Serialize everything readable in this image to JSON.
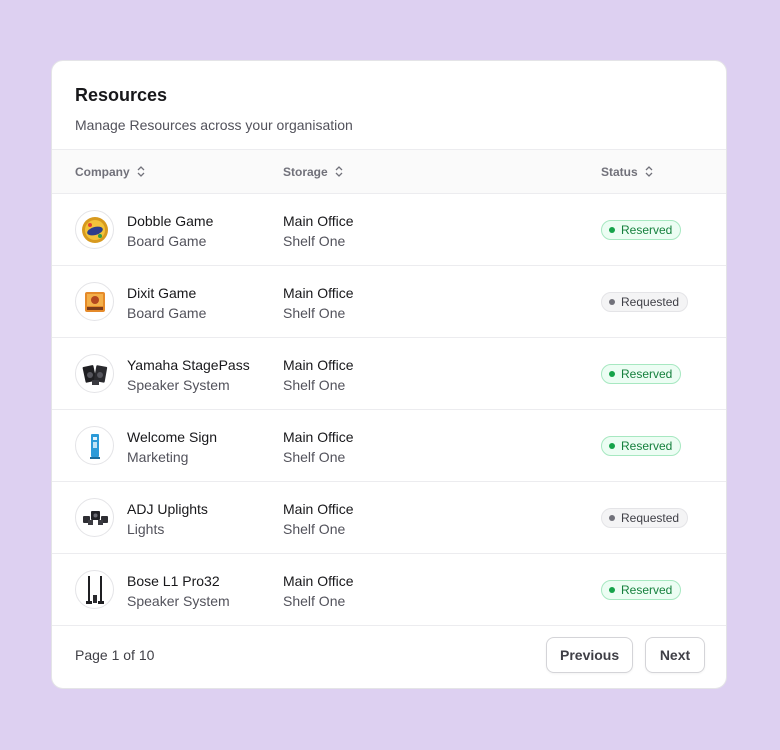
{
  "card": {
    "title": "Resources",
    "subtitle": "Manage Resources across your organisation"
  },
  "table": {
    "columns": [
      "Company",
      "Storage",
      "Status"
    ],
    "rows": [
      {
        "name": "Dobble Game",
        "category": "Board Game",
        "location": "Main Office",
        "shelf": "Shelf One",
        "status": "Reserved",
        "status_type": "reserved",
        "icon": "dobble-game-icon"
      },
      {
        "name": "Dixit Game",
        "category": "Board Game",
        "location": "Main Office",
        "shelf": "Shelf One",
        "status": "Requested",
        "status_type": "requested",
        "icon": "dixit-game-icon"
      },
      {
        "name": "Yamaha StagePass",
        "category": "Speaker System",
        "location": "Main Office",
        "shelf": "Shelf One",
        "status": "Reserved",
        "status_type": "reserved",
        "icon": "speaker-system-icon"
      },
      {
        "name": "Welcome Sign",
        "category": "Marketing",
        "location": "Main Office",
        "shelf": "Shelf One",
        "status": "Reserved",
        "status_type": "reserved",
        "icon": "welcome-sign-icon"
      },
      {
        "name": "ADJ Uplights",
        "category": "Lights",
        "location": "Main Office",
        "shelf": "Shelf One",
        "status": "Requested",
        "status_type": "requested",
        "icon": "uplights-icon"
      },
      {
        "name": "Bose L1 Pro32",
        "category": "Speaker System",
        "location": "Main Office",
        "shelf": "Shelf One",
        "status": "Reserved",
        "status_type": "reserved",
        "icon": "column-speaker-icon"
      }
    ]
  },
  "footer": {
    "page_info": "Page 1 of 10",
    "previous_label": "Previous",
    "next_label": "Next"
  },
  "colors": {
    "background": "#ddd0f1",
    "reserved": "#16a34a",
    "requested": "#71717a"
  }
}
